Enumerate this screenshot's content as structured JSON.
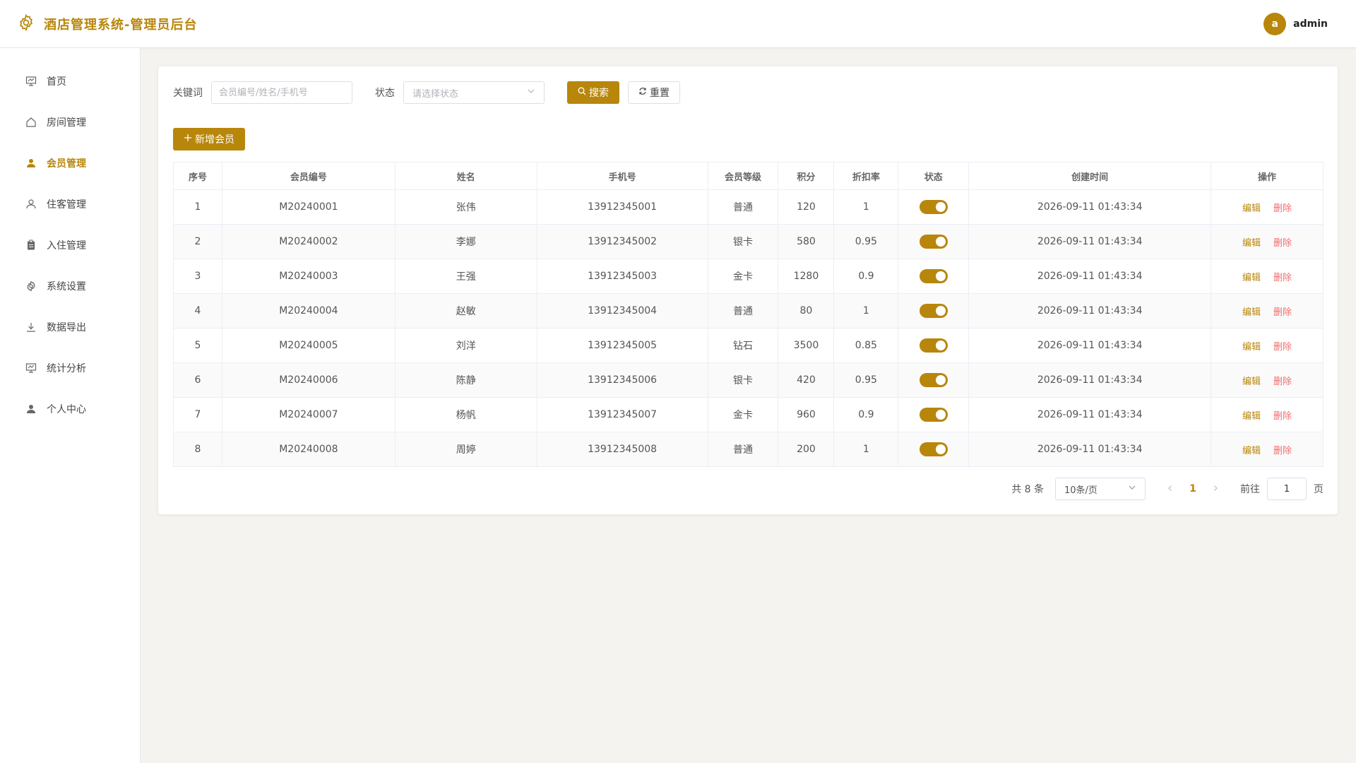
{
  "header": {
    "title": "酒店管理系统-管理员后台",
    "avatar_letter": "a",
    "username": "admin"
  },
  "sidebar": {
    "items": [
      {
        "label": "首页",
        "icon": "presentation-icon"
      },
      {
        "label": "房间管理",
        "icon": "house-icon"
      },
      {
        "label": "会员管理",
        "icon": "user-filled-icon",
        "active": true
      },
      {
        "label": "住客管理",
        "icon": "user-icon"
      },
      {
        "label": "入住管理",
        "icon": "clipboard-icon"
      },
      {
        "label": "系统设置",
        "icon": "gear-icon"
      },
      {
        "label": "数据导出",
        "icon": "download-icon"
      },
      {
        "label": "统计分析",
        "icon": "presentation-icon"
      },
      {
        "label": "个人中心",
        "icon": "user-filled-icon"
      }
    ]
  },
  "filters": {
    "keyword_label": "关键词",
    "keyword_placeholder": "会员编号/姓名/手机号",
    "status_label": "状态",
    "status_placeholder": "请选择状态",
    "search_label": "搜索",
    "reset_label": "重置"
  },
  "add_label": "新增会员",
  "table": {
    "columns": [
      "序号",
      "会员编号",
      "姓名",
      "手机号",
      "会员等级",
      "积分",
      "折扣率",
      "状态",
      "创建时间",
      "操作"
    ],
    "rows": [
      [
        "1",
        "M20240001",
        "张伟",
        "13912345001",
        "普通",
        "120",
        "1",
        "2026-09-11 01:43:34"
      ],
      [
        "2",
        "M20240002",
        "李娜",
        "13912345002",
        "银卡",
        "580",
        "0.95",
        "2026-09-11 01:43:34"
      ],
      [
        "3",
        "M20240003",
        "王强",
        "13912345003",
        "金卡",
        "1280",
        "0.9",
        "2026-09-11 01:43:34"
      ],
      [
        "4",
        "M20240004",
        "赵敏",
        "13912345004",
        "普通",
        "80",
        "1",
        "2026-09-11 01:43:34"
      ],
      [
        "5",
        "M20240005",
        "刘洋",
        "13912345005",
        "钻石",
        "3500",
        "0.85",
        "2026-09-11 01:43:34"
      ],
      [
        "6",
        "M20240006",
        "陈静",
        "13912345006",
        "银卡",
        "420",
        "0.95",
        "2026-09-11 01:43:34"
      ],
      [
        "7",
        "M20240007",
        "杨帆",
        "13912345007",
        "金卡",
        "960",
        "0.9",
        "2026-09-11 01:43:34"
      ],
      [
        "8",
        "M20240008",
        "周婷",
        "13912345008",
        "普通",
        "200",
        "1",
        "2026-09-11 01:43:34"
      ]
    ],
    "edit_label": "编辑",
    "delete_label": "删除"
  },
  "pagination": {
    "total_text": "共 8 条",
    "page_size": "10条/页",
    "current_page": "1",
    "goto_label": "前往",
    "goto_value": "1",
    "page_suffix": "页"
  },
  "colors": {
    "accent": "#b8860b",
    "danger": "#f56c6c",
    "background": "#f5f3ef"
  }
}
